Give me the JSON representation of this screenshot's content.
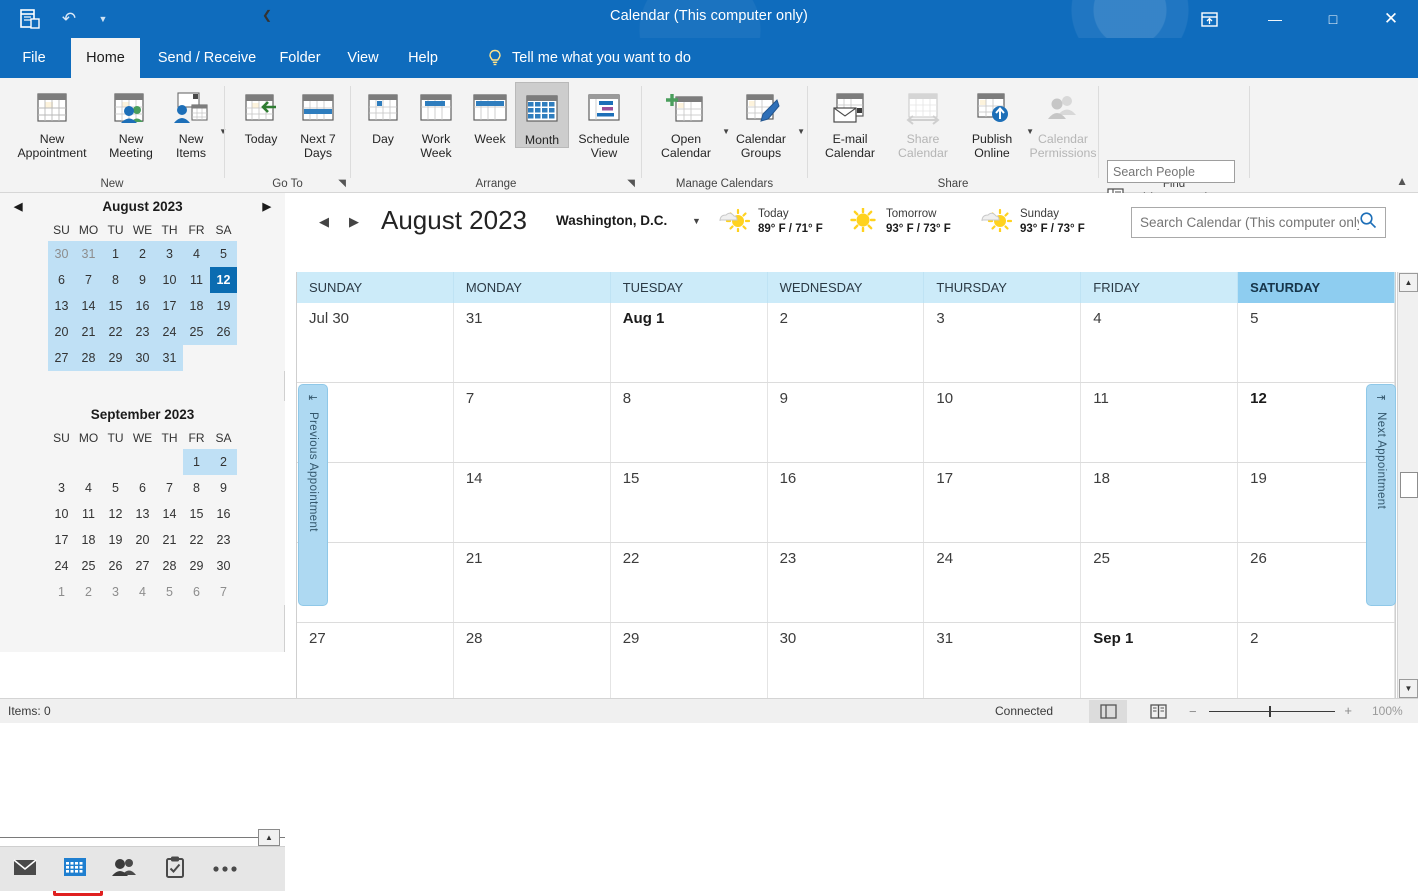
{
  "window": {
    "title": "Calendar (This computer only)",
    "qat": {
      "icon": "calendar-app-icon",
      "undo": "undo-icon",
      "customize": "chevron-down-icon"
    },
    "controls": {
      "ribbon_display": "ribbon-display-options-icon",
      "minimize": "—",
      "maximize": "□",
      "close": "✕"
    }
  },
  "menu": {
    "tabs": [
      {
        "id": "file",
        "label": "File"
      },
      {
        "id": "home",
        "label": "Home"
      },
      {
        "id": "send-receive",
        "label": "Send / Receive"
      },
      {
        "id": "folder",
        "label": "Folder"
      },
      {
        "id": "view",
        "label": "View"
      },
      {
        "id": "help",
        "label": "Help"
      }
    ],
    "active_tab": "Home",
    "highlighted_tab": "View",
    "tellme": "Tell me what you want to do"
  },
  "ribbon": {
    "groups": [
      {
        "id": "new",
        "label": "New"
      },
      {
        "id": "go-to",
        "label": "Go To"
      },
      {
        "id": "arrange",
        "label": "Arrange"
      },
      {
        "id": "manage-calendars",
        "label": "Manage Calendars"
      },
      {
        "id": "share",
        "label": "Share"
      },
      {
        "id": "find",
        "label": "Find"
      }
    ],
    "buttons": {
      "new_appointment": "New\nAppointment",
      "new_meeting": "New\nMeeting",
      "new_items": "New\nItems",
      "today": "Today",
      "next_7_days": "Next 7\nDays",
      "day": "Day",
      "work_week": "Work\nWeek",
      "week": "Week",
      "month": "Month",
      "schedule_view": "Schedule\nView",
      "open_calendar": "Open\nCalendar",
      "calendar_groups": "Calendar\nGroups",
      "email_calendar": "E-mail\nCalendar",
      "share_calendar": "Share\nCalendar",
      "publish_online": "Publish\nOnline",
      "calendar_permissions": "Calendar\nPermissions"
    },
    "selected_button": "Month",
    "disabled_buttons": [
      "Share Calendar",
      "Calendar Permissions"
    ],
    "find": {
      "search_people_placeholder": "Search People",
      "address_book_label": "Address Book",
      "address_book_icon": "address-book-icon"
    },
    "collapse_icon": "chevron-up-icon"
  },
  "navpane": {
    "collapse_icon": "chevron-left-icon",
    "datenav": [
      {
        "title": "August 2023",
        "prev_icon": "triangle-left-icon",
        "next_icon": "triangle-right-icon",
        "dow": [
          "SU",
          "MO",
          "TU",
          "WE",
          "TH",
          "FR",
          "SA"
        ],
        "weeks": [
          [
            {
              "d": "30",
              "s": "other inrange"
            },
            {
              "d": "31",
              "s": "other inrange"
            },
            {
              "d": "1",
              "s": "inrange"
            },
            {
              "d": "2",
              "s": "inrange"
            },
            {
              "d": "3",
              "s": "inrange"
            },
            {
              "d": "4",
              "s": "inrange"
            },
            {
              "d": "5",
              "s": "inrange"
            }
          ],
          [
            {
              "d": "6",
              "s": "inrange"
            },
            {
              "d": "7",
              "s": "inrange"
            },
            {
              "d": "8",
              "s": "inrange"
            },
            {
              "d": "9",
              "s": "inrange"
            },
            {
              "d": "10",
              "s": "inrange"
            },
            {
              "d": "11",
              "s": "inrange"
            },
            {
              "d": "12",
              "s": "today"
            }
          ],
          [
            {
              "d": "13",
              "s": "inrange"
            },
            {
              "d": "14",
              "s": "inrange"
            },
            {
              "d": "15",
              "s": "inrange"
            },
            {
              "d": "16",
              "s": "inrange"
            },
            {
              "d": "17",
              "s": "inrange"
            },
            {
              "d": "18",
              "s": "inrange"
            },
            {
              "d": "19",
              "s": "inrange"
            }
          ],
          [
            {
              "d": "20",
              "s": "inrange"
            },
            {
              "d": "21",
              "s": "inrange"
            },
            {
              "d": "22",
              "s": "inrange"
            },
            {
              "d": "23",
              "s": "inrange"
            },
            {
              "d": "24",
              "s": "inrange"
            },
            {
              "d": "25",
              "s": "inrange"
            },
            {
              "d": "26",
              "s": "inrange"
            }
          ],
          [
            {
              "d": "27",
              "s": "inrange"
            },
            {
              "d": "28",
              "s": "inrange"
            },
            {
              "d": "29",
              "s": "inrange"
            },
            {
              "d": "30",
              "s": "inrange"
            },
            {
              "d": "31",
              "s": "inrange"
            },
            {
              "d": "",
              "s": ""
            },
            {
              "d": "",
              "s": ""
            }
          ]
        ]
      },
      {
        "title": "September 2023",
        "dow": [
          "SU",
          "MO",
          "TU",
          "WE",
          "TH",
          "FR",
          "SA"
        ],
        "weeks": [
          [
            {
              "d": "",
              "s": ""
            },
            {
              "d": "",
              "s": ""
            },
            {
              "d": "",
              "s": ""
            },
            {
              "d": "",
              "s": ""
            },
            {
              "d": "",
              "s": ""
            },
            {
              "d": "1",
              "s": "inrange"
            },
            {
              "d": "2",
              "s": "inrange"
            }
          ],
          [
            {
              "d": "3",
              "s": ""
            },
            {
              "d": "4",
              "s": ""
            },
            {
              "d": "5",
              "s": ""
            },
            {
              "d": "6",
              "s": ""
            },
            {
              "d": "7",
              "s": ""
            },
            {
              "d": "8",
              "s": ""
            },
            {
              "d": "9",
              "s": ""
            }
          ],
          [
            {
              "d": "10",
              "s": ""
            },
            {
              "d": "11",
              "s": ""
            },
            {
              "d": "12",
              "s": ""
            },
            {
              "d": "13",
              "s": ""
            },
            {
              "d": "14",
              "s": ""
            },
            {
              "d": "15",
              "s": ""
            },
            {
              "d": "16",
              "s": ""
            }
          ],
          [
            {
              "d": "17",
              "s": ""
            },
            {
              "d": "18",
              "s": ""
            },
            {
              "d": "19",
              "s": ""
            },
            {
              "d": "20",
              "s": ""
            },
            {
              "d": "21",
              "s": ""
            },
            {
              "d": "22",
              "s": ""
            },
            {
              "d": "23",
              "s": ""
            }
          ],
          [
            {
              "d": "24",
              "s": ""
            },
            {
              "d": "25",
              "s": ""
            },
            {
              "d": "26",
              "s": ""
            },
            {
              "d": "27",
              "s": ""
            },
            {
              "d": "28",
              "s": ""
            },
            {
              "d": "29",
              "s": ""
            },
            {
              "d": "30",
              "s": ""
            }
          ],
          [
            {
              "d": "1",
              "s": "other"
            },
            {
              "d": "2",
              "s": "other"
            },
            {
              "d": "3",
              "s": "other"
            },
            {
              "d": "4",
              "s": "other"
            },
            {
              "d": "5",
              "s": "other"
            },
            {
              "d": "6",
              "s": "other"
            },
            {
              "d": "7",
              "s": "other"
            }
          ]
        ]
      }
    ],
    "modules": [
      {
        "id": "mail",
        "icon": "mail-icon",
        "selected": false
      },
      {
        "id": "calendar",
        "icon": "calendar-icon",
        "selected": true
      },
      {
        "id": "people",
        "icon": "people-icon",
        "selected": false
      },
      {
        "id": "tasks",
        "icon": "tasks-icon",
        "selected": false
      },
      {
        "id": "more",
        "icon": "ellipsis-icon",
        "selected": false
      }
    ],
    "expand_icon": "chevron-up-icon"
  },
  "calendar_header": {
    "prev_icon": "triangle-left-icon",
    "next_icon": "triangle-right-icon",
    "title": "August 2023",
    "location": "Washington,  D.C.",
    "location_caret": "chevron-down-icon",
    "weather": [
      {
        "day": "Today",
        "temps": "89° F / 71° F",
        "icon": "partly-sunny-icon"
      },
      {
        "day": "Tomorrow",
        "temps": "93° F / 73° F",
        "icon": "sunny-icon"
      },
      {
        "day": "Sunday",
        "temps": "93° F / 73° F",
        "icon": "partly-sunny-icon"
      }
    ],
    "search_placeholder": "Search Calendar (This computer only)",
    "search_value": "",
    "search_icon": "search-icon"
  },
  "month_grid": {
    "day_headers": [
      "SUNDAY",
      "MONDAY",
      "TUESDAY",
      "WEDNESDAY",
      "THURSDAY",
      "FRIDAY",
      "SATURDAY"
    ],
    "selected_column": "SATURDAY",
    "selected_week_index": 1,
    "weeks": [
      [
        {
          "label": "Jul 30",
          "bold": false
        },
        {
          "label": "31",
          "bold": false
        },
        {
          "label": "Aug 1",
          "bold": true
        },
        {
          "label": "2",
          "bold": false
        },
        {
          "label": "3",
          "bold": false
        },
        {
          "label": "4",
          "bold": false
        },
        {
          "label": "5",
          "bold": false
        }
      ],
      [
        {
          "label": "",
          "bold": false
        },
        {
          "label": "7",
          "bold": false
        },
        {
          "label": "8",
          "bold": false
        },
        {
          "label": "9",
          "bold": false
        },
        {
          "label": "10",
          "bold": false
        },
        {
          "label": "11",
          "bold": false
        },
        {
          "label": "12",
          "bold": true
        }
      ],
      [
        {
          "label": "",
          "bold": false
        },
        {
          "label": "14",
          "bold": false
        },
        {
          "label": "15",
          "bold": false
        },
        {
          "label": "16",
          "bold": false
        },
        {
          "label": "17",
          "bold": false
        },
        {
          "label": "18",
          "bold": false
        },
        {
          "label": "19",
          "bold": false
        }
      ],
      [
        {
          "label": "",
          "bold": false
        },
        {
          "label": "21",
          "bold": false
        },
        {
          "label": "22",
          "bold": false
        },
        {
          "label": "23",
          "bold": false
        },
        {
          "label": "24",
          "bold": false
        },
        {
          "label": "25",
          "bold": false
        },
        {
          "label": "26",
          "bold": false
        }
      ],
      [
        {
          "label": "27",
          "bold": false
        },
        {
          "label": "28",
          "bold": false
        },
        {
          "label": "29",
          "bold": false
        },
        {
          "label": "30",
          "bold": false
        },
        {
          "label": "31",
          "bold": false
        },
        {
          "label": "Sep 1",
          "bold": true
        },
        {
          "label": "2",
          "bold": false
        }
      ]
    ],
    "previous_appointment_label": "Previous Appointment",
    "next_appointment_label": "Next Appointment",
    "scrollbar": {
      "up_icon": "triangle-up-icon",
      "down_icon": "triangle-down-icon"
    }
  },
  "statusbar": {
    "items": "Items: 0",
    "connection": "Connected",
    "view_normal_icon": "reading-pane-icon",
    "view_reading_icon": "reading-view-icon",
    "zoom_minus": "−",
    "zoom_plus": "+",
    "zoom_level": "100%"
  },
  "colors": {
    "brand_blue": "#0f6cbd",
    "highlight_red": "#e02020",
    "header_blue": "#ccebf9",
    "selected_col_blue": "#8ecdf0",
    "today_blue": "#0b6cb1",
    "range_blue": "#bfe0f5"
  }
}
